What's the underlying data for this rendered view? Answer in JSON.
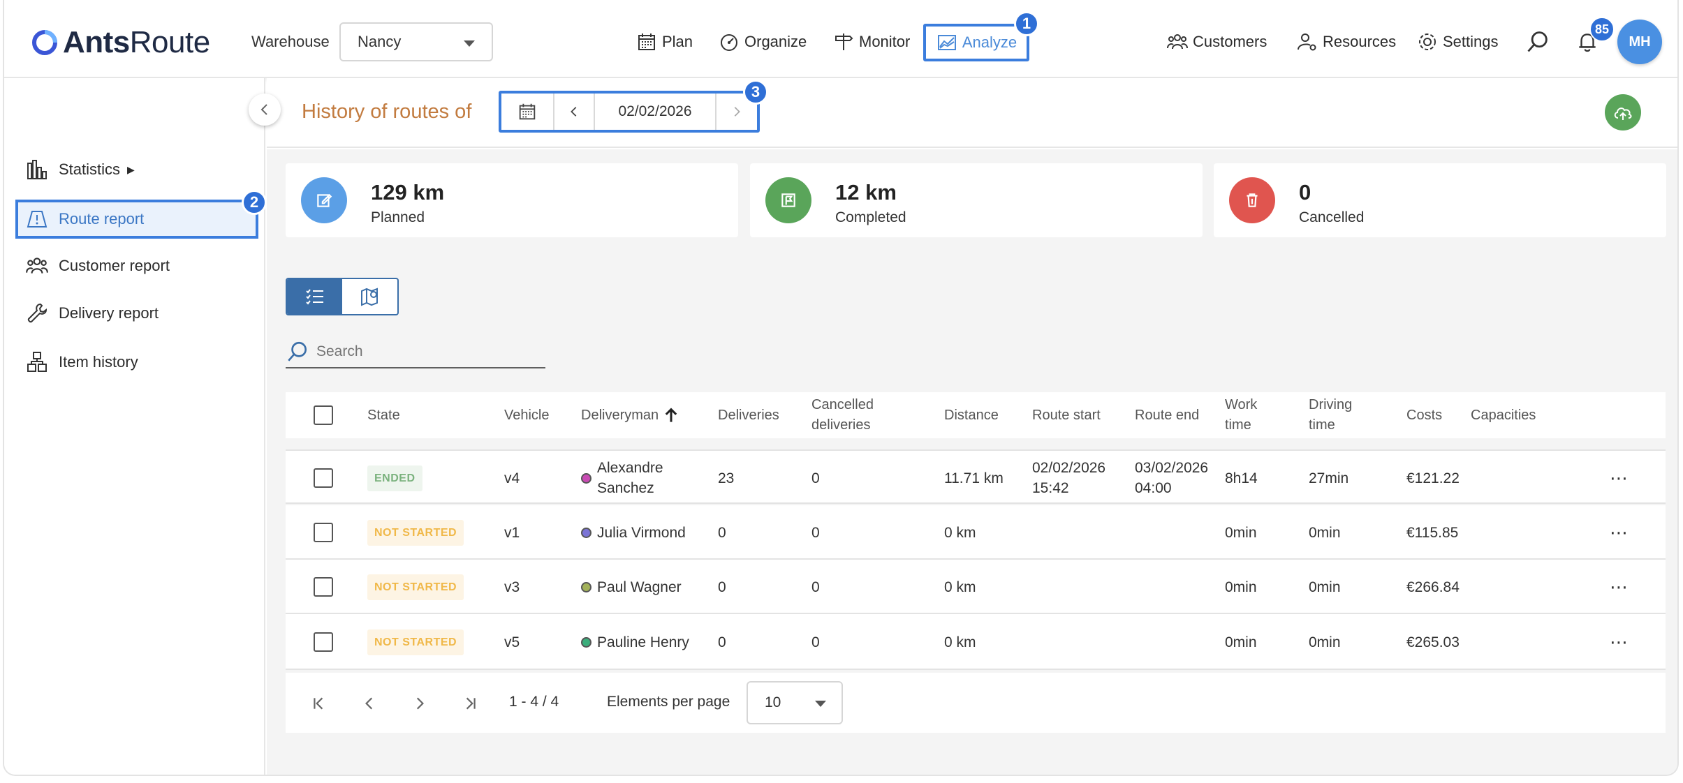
{
  "app": {
    "logo_bold": "Ants",
    "logo_rest": "Route"
  },
  "header": {
    "warehouse_label": "Warehouse",
    "warehouse_value": "Nancy",
    "nav": {
      "plan": "Plan",
      "organize": "Organize",
      "monitor": "Monitor",
      "analyze": "Analyze",
      "customers": "Customers",
      "resources": "Resources",
      "settings": "Settings"
    },
    "notifications_count": "85",
    "avatar_initials": "MH"
  },
  "annotations": {
    "a1": "1",
    "a2": "2",
    "a3": "3"
  },
  "sidebar": {
    "statistics": "Statistics",
    "statistics_arrow": "▶",
    "route_report": "Route report",
    "customer_report": "Customer report",
    "delivery_report": "Delivery report",
    "item_history": "Item history"
  },
  "main": {
    "title": "History of routes of",
    "date": "02/02/2026",
    "stats": [
      {
        "value": "129 km",
        "label": "Planned",
        "color": "#5b9fe6"
      },
      {
        "value": "12 km",
        "label": "Completed",
        "color": "#5aa55a"
      },
      {
        "value": "0",
        "label": "Cancelled",
        "color": "#e0554f"
      }
    ],
    "search_placeholder": "Search"
  },
  "table": {
    "headers": {
      "state": "State",
      "vehicle": "Vehicle",
      "deliveryman": "Deliveryman",
      "deliveries": "Deliveries",
      "cancelled_1": "Cancelled",
      "cancelled_2": "deliveries",
      "distance": "Distance",
      "route_start": "Route start",
      "route_end": "Route end",
      "work_1": "Work",
      "work_2": "time",
      "driving_1": "Driving",
      "driving_2": "time",
      "costs": "Costs",
      "capacities": "Capacities"
    },
    "rows": [
      {
        "state": "ENDED",
        "state_kind": "ended",
        "vehicle": "v4",
        "dot": "#c94bb4",
        "name_1": "Alexandre",
        "name_2": "Sanchez",
        "deliveries": "23",
        "cancelled": "0",
        "distance": "11.71 km",
        "start_1": "02/02/2026",
        "start_2": "15:42",
        "end_1": "03/02/2026",
        "end_2": "04:00",
        "work": "8h14",
        "driving": "27min",
        "costs": "€121.22",
        "more": "⋯"
      },
      {
        "state": "NOT STARTED",
        "state_kind": "ns",
        "vehicle": "v1",
        "dot": "#7b74d6",
        "name_1": "Julia Virmond",
        "name_2": "",
        "deliveries": "0",
        "cancelled": "0",
        "distance": "0 km",
        "start_1": "",
        "start_2": "",
        "end_1": "",
        "end_2": "",
        "work": "0min",
        "driving": "0min",
        "costs": "€115.85",
        "more": "⋯"
      },
      {
        "state": "NOT STARTED",
        "state_kind": "ns",
        "vehicle": "v3",
        "dot": "#a3b25a",
        "name_1": "Paul Wagner",
        "name_2": "",
        "deliveries": "0",
        "cancelled": "0",
        "distance": "0 km",
        "start_1": "",
        "start_2": "",
        "end_1": "",
        "end_2": "",
        "work": "0min",
        "driving": "0min",
        "costs": "€266.84",
        "more": "⋯"
      },
      {
        "state": "NOT STARTED",
        "state_kind": "ns",
        "vehicle": "v5",
        "dot": "#3cae7c",
        "name_1": "Pauline Henry",
        "name_2": "",
        "deliveries": "0",
        "cancelled": "0",
        "distance": "0 km",
        "start_1": "",
        "start_2": "",
        "end_1": "",
        "end_2": "",
        "work": "0min",
        "driving": "0min",
        "costs": "€265.03",
        "more": "⋯"
      }
    ]
  },
  "pagination": {
    "range": "1 - 4 / 4",
    "per_page_label": "Elements per page",
    "per_page_value": "10"
  }
}
